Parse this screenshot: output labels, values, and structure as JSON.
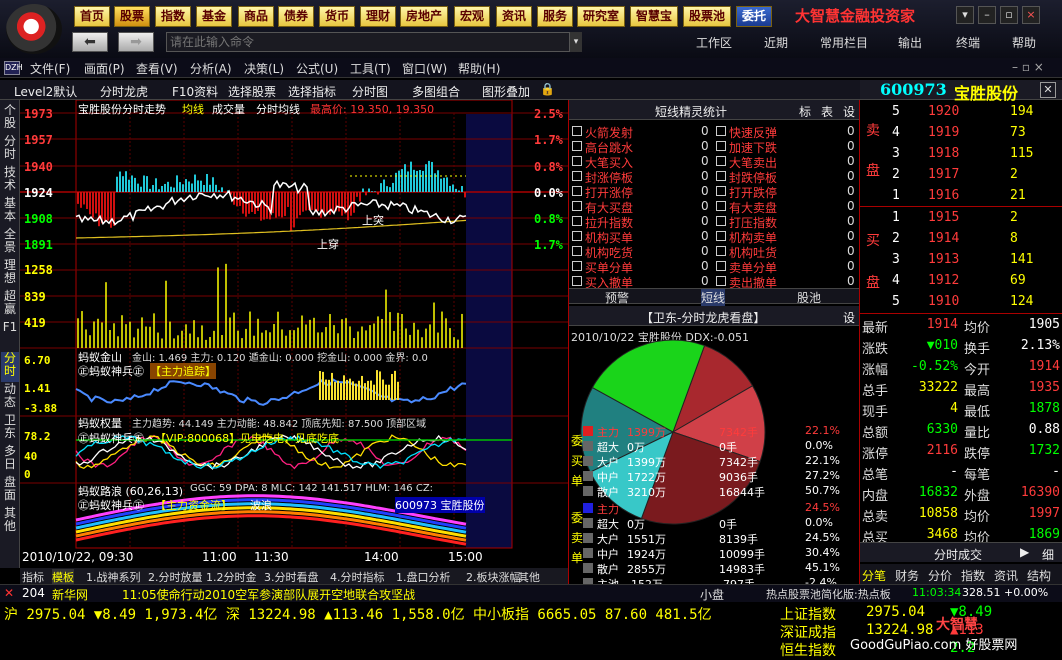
{
  "nav": [
    "首页",
    "股票",
    "指数",
    "基金",
    "商品",
    "债券",
    "货币",
    "理财",
    "房地产",
    "宏观",
    "资讯",
    "服务",
    "研究室",
    "智慧宝",
    "股票池",
    "委托"
  ],
  "brand": "大智慧金融投资家",
  "cmd_placeholder": "请在此输入命令",
  "right_menu": [
    "工作区",
    "近期",
    "常用栏目",
    "输出",
    "终端",
    "帮助"
  ],
  "menu": [
    "文件(F)",
    "画面(P)",
    "查看(V)",
    "分析(A)",
    "决策(L)",
    "公式(U)",
    "工具(T)",
    "窗口(W)",
    "帮助(H)"
  ],
  "toolbar": [
    "Level2默认",
    "分时龙虎",
    "F10资料",
    "选择股票",
    "选择指标",
    "分时图",
    "多图组合",
    "图形叠加"
  ],
  "left_tabs": [
    "个股",
    "分时",
    "技术",
    "基本",
    "全景",
    "理想",
    "超赢",
    "F1",
    "分时",
    "动态",
    "卫东",
    "多日",
    "盘面",
    "其他"
  ],
  "chart": {
    "title": "宝胜股份分时走势",
    "legend": [
      "均线",
      "成交量",
      "分时均线"
    ],
    "high_label": "最高价: 19.350, 19.350",
    "prices": [
      "1973",
      "1957",
      "1940",
      "1924",
      "1908",
      "1891"
    ],
    "vols": [
      "1258",
      "839",
      "419"
    ],
    "pcts": [
      "2.5%",
      "1.7%",
      "0.8%",
      "0.0%",
      "0.8%",
      "1.7%"
    ],
    "sub1_title": "蚂蚁金山",
    "sub1_vals": "金山: 1.469  主力: 0.120  遁金山: 0.000  挖金山: 0.000  金界: 0.0",
    "sub1_labels": [
      "6.70",
      "1.41",
      "-3.88"
    ],
    "sub1_text": "㊣蚂蚁神兵㊣",
    "sub1_tag": "【主力追踪】",
    "sub2_title": "蚂蚁权量",
    "sub2_vals": "主力趋势: 44.149  主力动能: 48.842  顶底先知: 87.500  顶部区域",
    "sub2_text": "㊣蚂蚁神兵㊣",
    "sub2_tag": "【VIP:800068】",
    "sub2_note": "见电吃电，见底吃底",
    "sub2_labels": [
      "78.2",
      "40",
      "0"
    ],
    "sub3_title": "蚂蚁路浪 (60,26,13)",
    "sub3_vals": "GGC: 59  DPA: 8  MLC: 142  141.517  HLM: 146  CZ:",
    "sub3_text": "㊣蚂蚁神兵㊣",
    "sub3_tag": "【主力资金流】",
    "sub3_note": "波浪",
    "sub3_code": "600973 宝胜股份",
    "times": [
      "2010/10/22, 09:30",
      "11:00",
      "11:30",
      "14:00",
      "15:00"
    ],
    "annot": [
      "上穿",
      "上突",
      "顶",
      "顶",
      "B"
    ]
  },
  "bottom_tabs": [
    "指标",
    "模板",
    "1.战神系列",
    "2.分时放量",
    "1.2分时金",
    "3.分时看盘",
    "4.分时指标",
    "1.盘口分析",
    "2.板块涨幅",
    "其他"
  ],
  "spirit": {
    "title": "短线精灵统计",
    "tabs": [
      "标",
      "表",
      "设"
    ],
    "rows": [
      [
        "火箭发射",
        "0",
        "快速反弹",
        "0"
      ],
      [
        "高台跳水",
        "0",
        "加速下跌",
        "0"
      ],
      [
        "大笔买入",
        "0",
        "大笔卖出",
        "0"
      ],
      [
        "封涨停板",
        "0",
        "封跌停板",
        "0"
      ],
      [
        "打开涨停",
        "0",
        "打开跌停",
        "0"
      ],
      [
        "有大买盘",
        "0",
        "有大卖盘",
        "0"
      ],
      [
        "拉升指数",
        "0",
        "打压指数",
        "0"
      ],
      [
        "机构买单",
        "0",
        "机构卖单",
        "0"
      ],
      [
        "机构吃货",
        "0",
        "机构吐货",
        "0"
      ],
      [
        "买单分单",
        "0",
        "卖单分单",
        "0"
      ],
      [
        "买入撤单",
        "0",
        "卖出撤单",
        "0"
      ]
    ],
    "subtabs": [
      "预警",
      "短线",
      "股池"
    ]
  },
  "pie": {
    "title": "【卫东-分时龙虎看盘】",
    "set": "设",
    "header": "2010/10/22  宝胜股份  DDX:-0.051",
    "buy_label": "委买单",
    "sell_label": "委卖单",
    "buy": [
      [
        "主力",
        "1399万",
        "7342手",
        "22.1%"
      ],
      [
        "超大",
        "0万",
        "0手",
        "0.0%"
      ],
      [
        "大户",
        "1399万",
        "7342手",
        "22.1%"
      ],
      [
        "中户",
        "1722万",
        "9036手",
        "27.2%"
      ],
      [
        "散户",
        "3210万",
        "16844手",
        "50.7%"
      ]
    ],
    "sell": [
      [
        "主力",
        "",
        "",
        "24.5%"
      ],
      [
        "超大",
        "0万",
        "0手",
        "0.0%"
      ],
      [
        "大户",
        "1551万",
        "8139手",
        "24.5%"
      ],
      [
        "中户",
        "1924万",
        "10099手",
        "30.4%"
      ],
      [
        "散户",
        "2855万",
        "14983手",
        "45.1%"
      ],
      [
        "主池",
        "-152万",
        "-797手",
        "-2.4%"
      ]
    ],
    "slices": [
      22.1,
      27.2,
      50.7,
      24.5,
      30.4,
      45.1
    ],
    "colors": [
      "#a8282e",
      "#d04048",
      "#7a1a1e",
      "#38c8c8",
      "#208080",
      "#1ad41a"
    ]
  },
  "quote": {
    "code": "600973",
    "name": "宝胜股份",
    "asks": [
      [
        "5",
        "1920",
        "194"
      ],
      [
        "4",
        "1919",
        "73"
      ],
      [
        "3",
        "1918",
        "115"
      ],
      [
        "2",
        "1917",
        "2"
      ],
      [
        "1",
        "1916",
        "21"
      ]
    ],
    "bids": [
      [
        "1",
        "1915",
        "2"
      ],
      [
        "2",
        "1914",
        "8"
      ],
      [
        "3",
        "1913",
        "141"
      ],
      [
        "4",
        "1912",
        "69"
      ],
      [
        "5",
        "1910",
        "124"
      ]
    ],
    "sell_label": "卖盘",
    "buy_label": "买盘",
    "stats": [
      [
        "最新",
        "1914",
        "均价",
        "1905"
      ],
      [
        "涨跌",
        "▼010",
        "换手",
        "2.13%"
      ],
      [
        "涨幅",
        "-0.52%",
        "今开",
        "1914"
      ],
      [
        "总手",
        "33222",
        "最高",
        "1935"
      ],
      [
        "现手",
        "4",
        "最低",
        "1878"
      ],
      [
        "总额",
        "6330",
        "量比",
        "0.88"
      ],
      [
        "涨停",
        "2116",
        "跌停",
        "1732"
      ],
      [
        "总笔",
        "-",
        "每笔",
        "-"
      ],
      [
        "内盘",
        "16832",
        "外盘",
        "16390"
      ],
      [
        "总卖",
        "10858",
        "均价",
        "1997"
      ],
      [
        "总买",
        "3468",
        "均价",
        "1869"
      ]
    ],
    "trade_title": "分时成交",
    "trade_btn": "细",
    "tabs": [
      "分笔",
      "财务",
      "分价",
      "指数",
      "资讯",
      "结构"
    ]
  },
  "status": {
    "num": "204",
    "news_src": "新华网",
    "news": "11:05使命行动2010空军参演部队展开空地联合攻坚战",
    "pan": "小盘",
    "hot": "热点股票池简化版:热点板",
    "time": "11:03:34",
    "val": "328.51 +0.00%"
  },
  "ticker": {
    "row": "沪  2975.04  ▼8.49 1,973.4亿  深  13224.98  ▲113.46 1,558.0亿  中小板指 6665.05  87.60 481.5亿",
    "idx": [
      [
        "上证指数",
        "2975.04",
        "▼8.49"
      ],
      [
        "深证成指",
        "13224.98",
        "▲113"
      ],
      [
        "恒生指数",
        "",
        "2.2"
      ]
    ],
    "watermark": "GoodGuPiao.com 好股票网"
  }
}
